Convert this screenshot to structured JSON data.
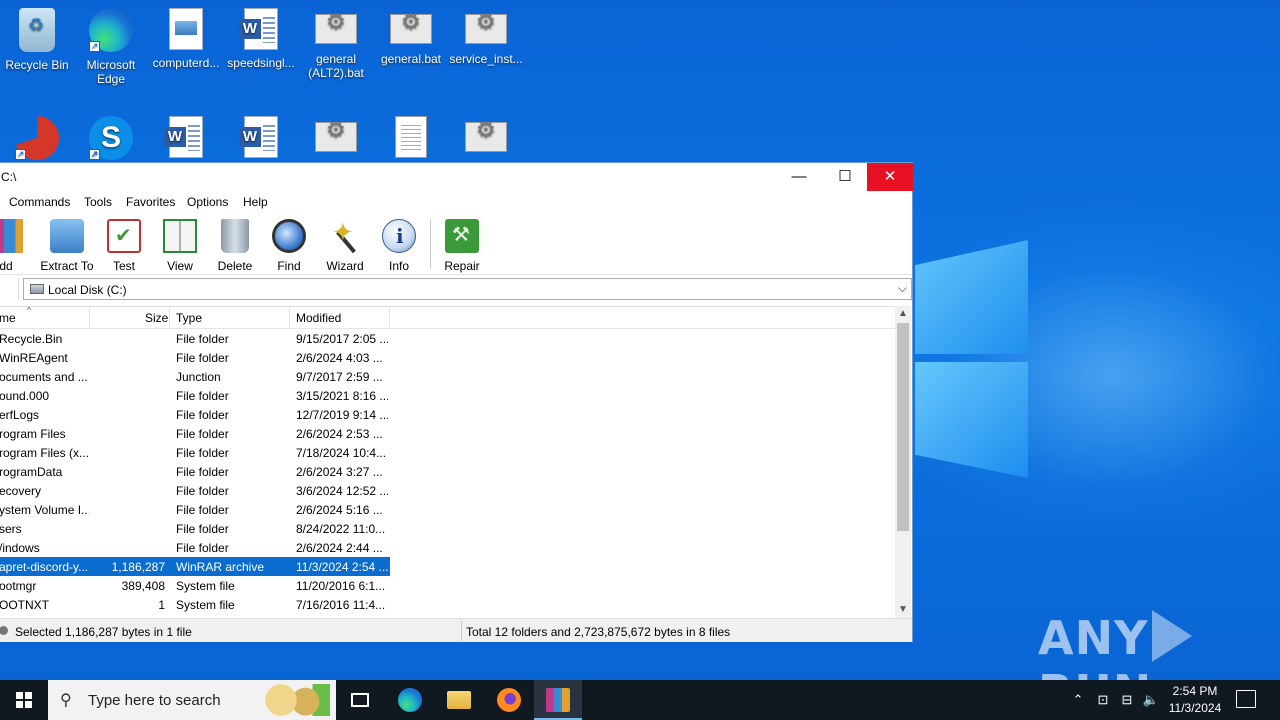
{
  "desktop": {
    "icons_row1": [
      {
        "label": "Recycle Bin",
        "icon": "recycle-bin-icon"
      },
      {
        "label": "Microsoft Edge",
        "icon": "edge-icon"
      },
      {
        "label": "computerd...",
        "icon": "image-file-icon"
      },
      {
        "label": "speedsingl...",
        "icon": "word-doc-icon"
      },
      {
        "label": "general (ALT2).bat",
        "icon": "batch-file-icon"
      },
      {
        "label": "general.bat",
        "icon": "batch-file-icon"
      },
      {
        "label": "service_inst...",
        "icon": "batch-file-icon"
      }
    ],
    "icons_row2": [
      {
        "icon": "ccleaner-icon"
      },
      {
        "icon": "skype-icon"
      },
      {
        "icon": "word-doc-icon"
      },
      {
        "icon": "word-doc-icon"
      },
      {
        "icon": "batch-file-icon"
      },
      {
        "icon": "text-file-icon"
      },
      {
        "icon": "batch-file-icon"
      }
    ]
  },
  "window": {
    "title": "C:\\",
    "menu": [
      "Commands",
      "Tools",
      "Favorites",
      "Options",
      "Help"
    ],
    "toolbar": [
      {
        "label": "Add",
        "icon": "add-archive-icon"
      },
      {
        "label": "Extract To",
        "icon": "extract-folder-icon"
      },
      {
        "label": "Test",
        "icon": "test-clipboard-icon"
      },
      {
        "label": "View",
        "icon": "view-book-icon"
      },
      {
        "label": "Delete",
        "icon": "trash-can-icon"
      },
      {
        "label": "Find",
        "icon": "magnifier-icon"
      },
      {
        "label": "Wizard",
        "icon": "magic-wand-icon"
      },
      {
        "label": "Info",
        "icon": "info-icon"
      },
      {
        "label": "Repair",
        "icon": "repair-kit-icon"
      }
    ],
    "address": "Local Disk (C:)",
    "columns": {
      "name": "me",
      "size": "Size",
      "type": "Type",
      "modified": "Modified"
    },
    "rows": [
      {
        "name": "Recycle.Bin",
        "size": "",
        "type": "File folder",
        "modified": "9/15/2017 2:05 ..."
      },
      {
        "name": "WinREAgent",
        "size": "",
        "type": "File folder",
        "modified": "2/6/2024 4:03 ..."
      },
      {
        "name": "ocuments and ...",
        "size": "",
        "type": "Junction",
        "modified": "9/7/2017 2:59 ..."
      },
      {
        "name": "ound.000",
        "size": "",
        "type": "File folder",
        "modified": "3/15/2021 8:16 ..."
      },
      {
        "name": "erfLogs",
        "size": "",
        "type": "File folder",
        "modified": "12/7/2019 9:14 ..."
      },
      {
        "name": "rogram Files",
        "size": "",
        "type": "File folder",
        "modified": "2/6/2024 2:53 ..."
      },
      {
        "name": "rogram Files (x...",
        "size": "",
        "type": "File folder",
        "modified": "7/18/2024 10:4..."
      },
      {
        "name": "rogramData",
        "size": "",
        "type": "File folder",
        "modified": "2/6/2024 3:27 ..."
      },
      {
        "name": "ecovery",
        "size": "",
        "type": "File folder",
        "modified": "3/6/2024 12:52 ..."
      },
      {
        "name": "ystem Volume I...",
        "size": "",
        "type": "File folder",
        "modified": "2/6/2024 5:16 ..."
      },
      {
        "name": "sers",
        "size": "",
        "type": "File folder",
        "modified": "8/24/2022 11:0..."
      },
      {
        "name": "/indows",
        "size": "",
        "type": "File folder",
        "modified": "2/6/2024 2:44 ..."
      },
      {
        "name": "apret-discord-y...",
        "size": "1,186,287",
        "type": "WinRAR archive",
        "modified": "11/3/2024 2:54 ...",
        "selected": true
      },
      {
        "name": "ootmgr",
        "size": "389,408",
        "type": "System file",
        "modified": "11/20/2016 6:1..."
      },
      {
        "name": "OOTNXT",
        "size": "1",
        "type": "System file",
        "modified": "7/16/2016 11:4..."
      }
    ],
    "status_left": "Selected 1,186,287 bytes in 1 file",
    "status_right": "Total 12 folders and 2,723,875,672 bytes in 8 files"
  },
  "taskbar": {
    "search_placeholder": "Type here to search",
    "apps": [
      "task-view-icon",
      "edge-icon",
      "file-explorer-icon",
      "firefox-icon",
      "winrar-icon"
    ],
    "time": "2:54 PM",
    "date": "11/3/2024"
  },
  "watermark": {
    "left": "ANY",
    "right": "RUN"
  }
}
